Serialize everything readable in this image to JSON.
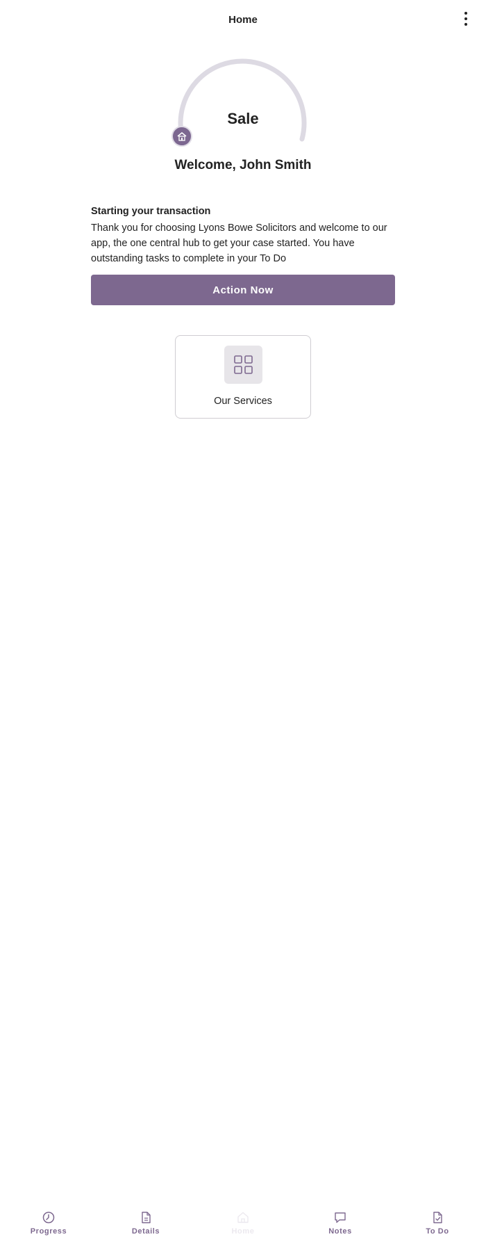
{
  "header": {
    "title": "Home",
    "menu_icon": "more-vertical-icon"
  },
  "case": {
    "stage": "Sale",
    "progress": 0.0,
    "welcome": "Welcome, John Smith"
  },
  "intro": {
    "heading": "Starting your transaction",
    "body": "Thank you for choosing Lyons Bowe Solicitors and welcome to our app, the one central hub to get your case started. You have outstanding tasks to complete in your To Do"
  },
  "actions": {
    "primary_label": "Action Now"
  },
  "services_card": {
    "label": "Our Services",
    "icon": "grid-icon"
  },
  "nav": {
    "items": [
      {
        "label": "Progress",
        "icon": "clock-icon",
        "active": true
      },
      {
        "label": "Details",
        "icon": "document-icon",
        "active": true
      },
      {
        "label": "Home",
        "icon": "home-icon",
        "active": false
      },
      {
        "label": "Notes",
        "icon": "chat-icon",
        "active": true
      },
      {
        "label": "To Do",
        "icon": "checklist-icon",
        "active": true
      }
    ]
  },
  "colors": {
    "accent": "#7d688f",
    "track": "#dddae3",
    "text": "#222222",
    "card_border": "#cfcdd2"
  }
}
